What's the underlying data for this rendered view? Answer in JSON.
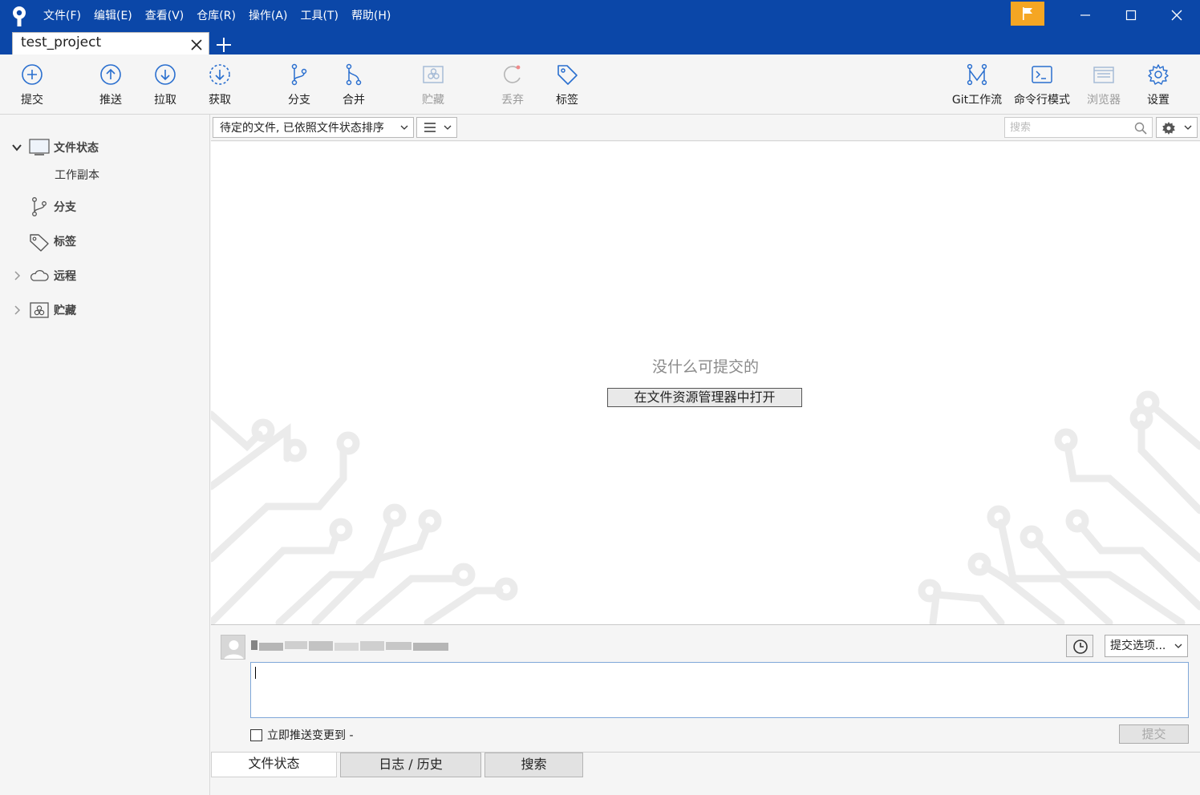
{
  "colors": {
    "titlebar": "#0b47a8",
    "flag": "#f5a623",
    "accent_icon": "#2a6fcf"
  },
  "menu": [
    "文件(F)",
    "编辑(E)",
    "查看(V)",
    "仓库(R)",
    "操作(A)",
    "工具(T)",
    "帮助(H)"
  ],
  "tab": {
    "label": "test_project"
  },
  "toolbar": {
    "commit": "提交",
    "push": "推送",
    "pull": "拉取",
    "fetch": "获取",
    "branch": "分支",
    "merge": "合并",
    "stash": "贮藏",
    "discard": "丢弃",
    "tag": "标签",
    "git_flow": "Git工作流",
    "terminal": "命令行模式",
    "explorer": "浏览器",
    "settings": "设置"
  },
  "sidebar": {
    "file_status": "文件状态",
    "working_copy": "工作副本",
    "branches": "分支",
    "tags": "标签",
    "remotes": "远程",
    "stashes": "贮藏"
  },
  "filterbar": {
    "sort_select": "待定的文件, 已依照文件状态排序",
    "search_placeholder": "搜索"
  },
  "content": {
    "empty_message": "没什么可提交的",
    "open_explorer": "在文件资源管理器中打开"
  },
  "commit_panel": {
    "options": "提交选项...",
    "push_immediately": "立即推送变更到 -",
    "commit_button": "提交"
  },
  "bottom_tabs": [
    "文件状态",
    "日志 / 历史",
    "搜索"
  ]
}
